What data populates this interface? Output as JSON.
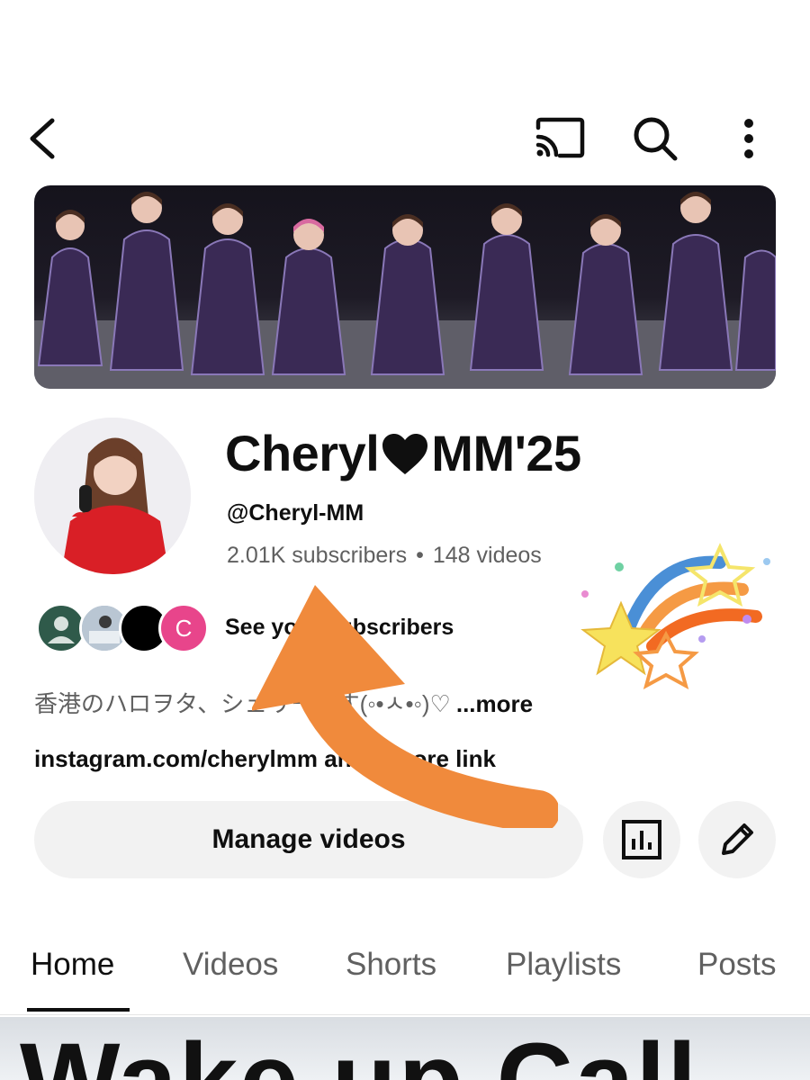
{
  "top_bar": {
    "back_icon": "chevron-left-icon",
    "actions": [
      "cast-icon",
      "search-icon",
      "more-vert-icon"
    ]
  },
  "banner": {
    "description": "banner-image"
  },
  "channel": {
    "name_part1": "Cheryl",
    "name_heart": "heart-icon",
    "name_part2": "MM'25",
    "handle": "@Cheryl-MM",
    "subscribers": "2.01K subscribers",
    "separator": "•",
    "videos": "148 videos"
  },
  "subscribers_row": {
    "label": "See your subscribers",
    "avatar_letter": "C"
  },
  "description": {
    "text": "香港のハロヲタ、シェリーです(◦•ㅅ•◦)♡",
    "more": "...more"
  },
  "links": {
    "text": "instagram.com/cherylmm and 6 more link"
  },
  "actions": {
    "manage_videos": "Manage videos",
    "analytics_icon": "analytics-icon",
    "edit_icon": "pencil-icon"
  },
  "tabs": [
    "Home",
    "Videos",
    "Shorts",
    "Playlists",
    "Posts"
  ],
  "thumbnail": {
    "text": "Wake up Call"
  },
  "colors": {
    "text_primary": "#0f0f0f",
    "text_secondary": "#606060",
    "button_bg": "#f2f2f2",
    "arrow": "#f08a3c",
    "sub_avatar_pink": "#e8458b"
  }
}
